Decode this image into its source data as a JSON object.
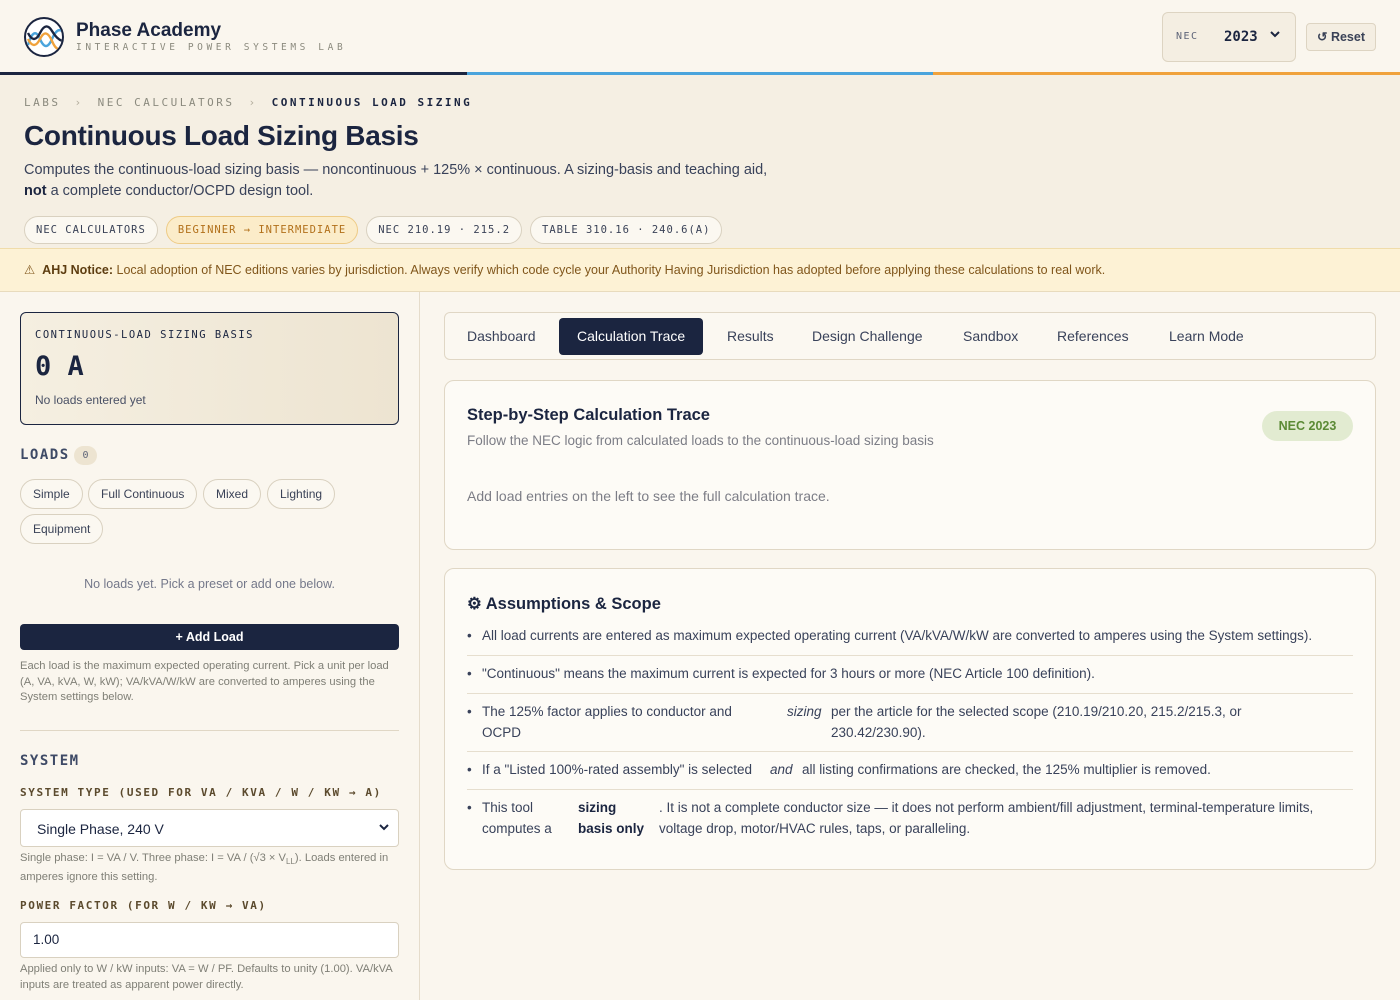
{
  "header": {
    "brand_name": "Phase Academy",
    "brand_sub": "INTERACTIVE POWER SYSTEMS LAB",
    "nec_label": "NEC",
    "nec_value": "2023",
    "reset_label": "↺ Reset"
  },
  "colors": {
    "navy": "#1b2540",
    "stripe_blue": "#4aa4dc",
    "stripe_orange": "#f0a23c",
    "notice_bg": "#fdf2d5"
  },
  "breadcrumb": [
    "LABS",
    "NEC CALCULATORS",
    "CONTINUOUS LOAD SIZING"
  ],
  "page": {
    "title": "Continuous Load Sizing Basis",
    "desc_1": "Computes the continuous-load sizing basis — noncontinuous + 125% × continuous. A sizing-basis and teaching aid,",
    "desc_not": "not",
    "desc_2": " a complete conductor/OCPD design tool."
  },
  "chips": [
    "NEC CALCULATORS",
    "BEGINNER → INTERMEDIATE",
    "NEC 210.19 · 215.2",
    "TABLE 310.16 · 240.6(A)"
  ],
  "notice": {
    "icon": "⚠",
    "label": "AHJ Notice:",
    "text": "Local adoption of NEC editions varies by jurisdiction. Always verify which code cycle your Authority Having Jurisdiction has adopted before applying these calculations to real work."
  },
  "basis": {
    "label": "CONTINUOUS-LOAD SIZING BASIS",
    "value": "0 A",
    "sub": "No loads entered yet"
  },
  "loads": {
    "heading": "LOADS",
    "count": "0",
    "presets": [
      "Simple",
      "Full Continuous",
      "Mixed",
      "Lighting",
      "Equipment"
    ],
    "empty": "No loads yet. Pick a preset or add one below.",
    "add_label": "+ Add Load",
    "help": "Each load is the maximum expected operating current. Pick a unit per load (A, VA, kVA, W, kW); VA/kVA/W/kW are converted to amperes using the System settings below."
  },
  "system": {
    "heading": "SYSTEM",
    "type_label": "SYSTEM TYPE (USED FOR VA / KVA / W / KW → A)",
    "type_value": "Single Phase, 240 V",
    "type_help_1": "Single phase: I = VA / V. Three phase: I = VA / (√3 × V",
    "type_help_sub": "LL",
    "type_help_2": "). Loads entered in amperes ignore this setting.",
    "pf_label": "POWER FACTOR (FOR W / KW → VA)",
    "pf_value": "1.00",
    "pf_help": "Applied only to W / kW inputs: VA = W / PF. Defaults to unity (1.00). VA/kVA inputs are treated as apparent power directly."
  },
  "tabs": [
    "Dashboard",
    "Calculation Trace",
    "Results",
    "Design Challenge",
    "Sandbox",
    "References",
    "Learn Mode"
  ],
  "trace": {
    "title": "Step-by-Step Calculation Trace",
    "sub": "Follow the NEC logic from calculated loads to the continuous-load sizing basis",
    "badge": "NEC 2023",
    "empty": "Add load entries on the left to see the full calculation trace."
  },
  "scope": {
    "title": "⚙ Assumptions & Scope",
    "b1": "All load currents are entered as maximum expected operating current (VA/kVA/W/kW are converted to amperes using the System settings).",
    "b2": "\"Continuous\" means the maximum current is expected for 3 hours or more (NEC Article 100 definition).",
    "b3_a": "The 125% factor applies to conductor and OCPD",
    "b3_em": "sizing",
    "b3_b": "per the article for the selected scope (210.19/210.20, 215.2/215.3, or 230.42/230.90).",
    "b4_a": "If a \"Listed 100%-rated assembly\" is selected",
    "b4_em": "and",
    "b4_b": "all listing confirmations are checked, the 125% multiplier is removed.",
    "b5_a": "This tool computes a",
    "b5_b": "sizing basis only",
    "b5_c": ". It is not a complete conductor size — it does not perform ambient/fill adjustment, terminal-temperature limits, voltage drop, motor/HVAC rules, taps, or paralleling."
  }
}
